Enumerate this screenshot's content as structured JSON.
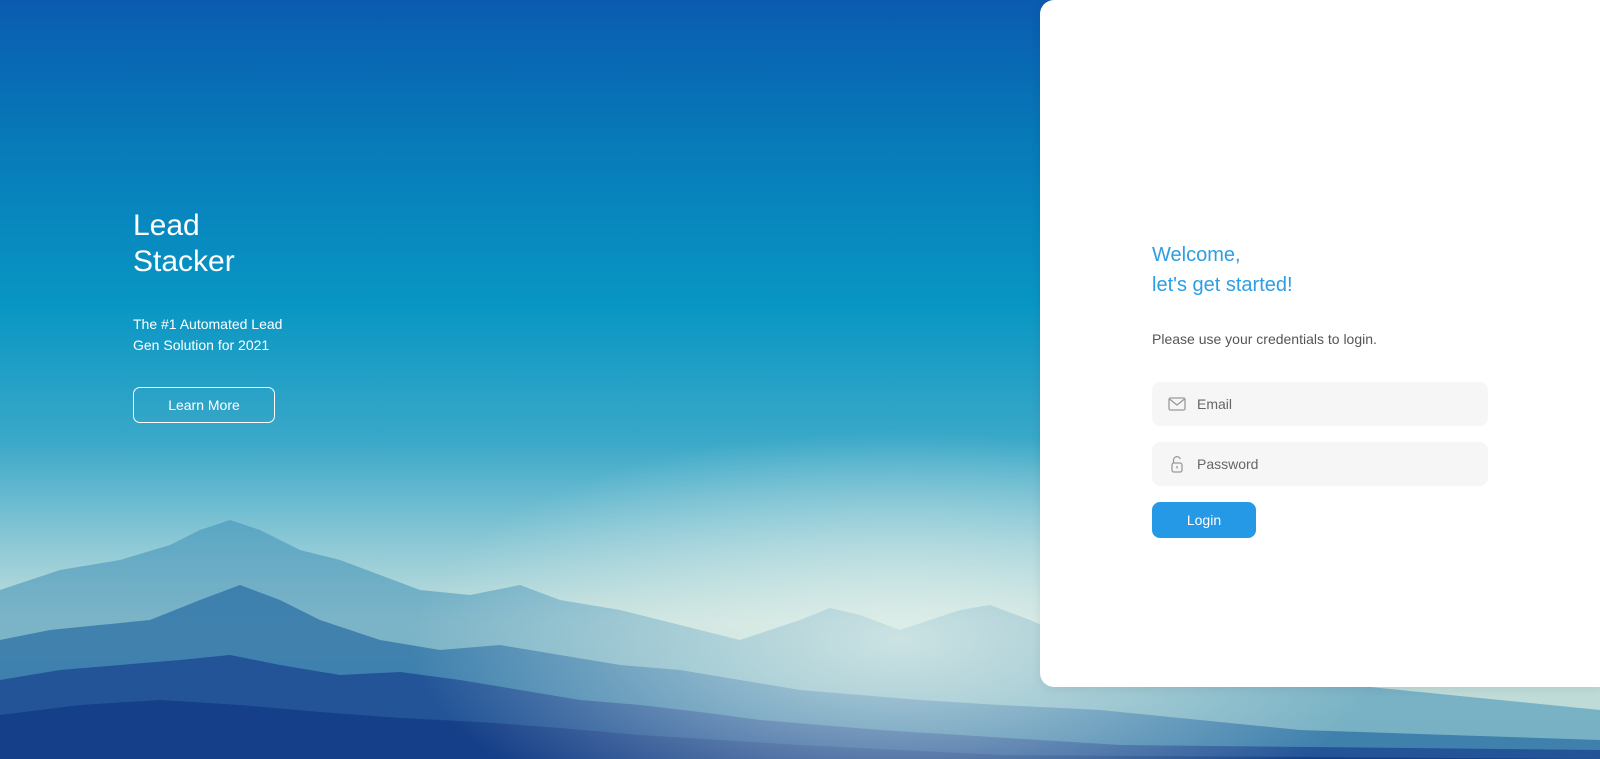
{
  "hero": {
    "title": "Lead Stacker",
    "subtitle": "The #1 Automated Lead Gen Solution for 2021",
    "learn_more_label": "Learn More"
  },
  "login": {
    "welcome_line1": "Welcome,",
    "welcome_line2": "let's get started!",
    "instructions": "Please use your credentials to login.",
    "email": {
      "placeholder": "Email",
      "value": "",
      "icon": "mail-icon"
    },
    "password": {
      "placeholder": "Password",
      "value": "",
      "icon": "lock-icon"
    },
    "submit_label": "Login"
  },
  "colors": {
    "accent": "#2699e6",
    "welcome_text": "#2e9ee2",
    "field_background": "#f6f6f6",
    "card_background": "#ffffff"
  }
}
